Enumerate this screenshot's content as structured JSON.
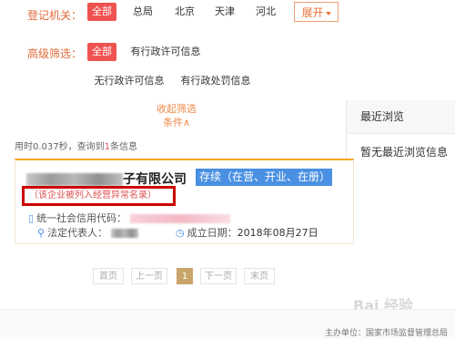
{
  "filters": {
    "registration_label": "登记机关：",
    "registration_options": [
      "全部",
      "总局",
      "北京",
      "天津",
      "河北"
    ],
    "expand_label": "展开",
    "advanced_label": "高级筛选：",
    "advanced_options": [
      "全部",
      "有行政许可信息",
      "无行政许可信息",
      "有行政处罚信息"
    ],
    "collapse_label_1": "收起筛选",
    "collapse_label_2": "条件∧"
  },
  "sidebar": {
    "header": "最近浏览",
    "empty": "暂无最近浏览信息"
  },
  "results": {
    "timing_prefix": "用时0.037秒，查询到",
    "count": "1",
    "timing_suffix": "条信息"
  },
  "card": {
    "company_suffix": "子有限公司",
    "status": "存续（在营、开业、在册）",
    "abnormal": "（该企业被列入经营异常名录）",
    "credit_label": "统一社会信用代码：",
    "legal_label": "法定代表人：",
    "date_label": "成立日期：",
    "date_value": "2018年08月27日"
  },
  "pagination": {
    "first": "首页",
    "prev": "上一页",
    "current": "1",
    "next": "下一页",
    "last": "末页"
  },
  "footer": {
    "text": "主办单位：国家市场监督管理总局"
  },
  "watermark": "Bai 经验",
  "colors": {
    "accent": "#ef5350",
    "orange": "#e8743b",
    "status_blue": "#4a90e2",
    "alert_red": "#c00"
  }
}
